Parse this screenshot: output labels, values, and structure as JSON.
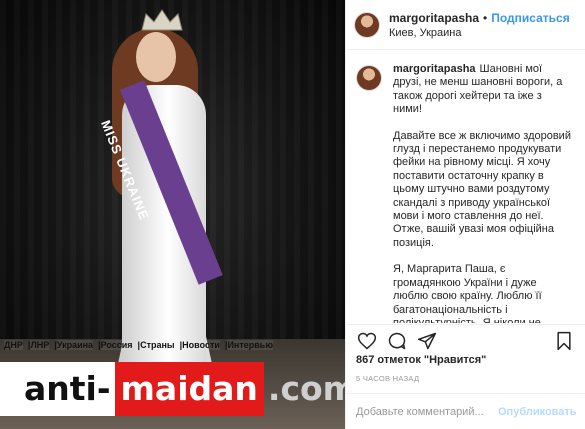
{
  "photo": {
    "sash_text": "MISS UKRAINE",
    "news_links": [
      "ДНР",
      "ЛНР",
      "Украина",
      "Россия",
      "Страны",
      "Новости",
      "Интервью"
    ],
    "watermark": {
      "part1": "anti-",
      "part2": "maidan",
      "part3": ".com"
    }
  },
  "header": {
    "username": "margoritapasha",
    "separator": "•",
    "follow_label": "Подписаться",
    "location": "Киев, Украина"
  },
  "caption": {
    "username": "margoritapasha",
    "paragraphs": [
      "Шановні мої друзі, не менш шановні вороги, а також дорогі хейтери та іже з ними!",
      "Давайте все ж включимо здоровий глузд і перестанемо продукувати фейки на рівному місці. Я хочу поставити остаточну крапку в цьому штучно вами роздутому скандалі з приводу української мови і мого ставлення до неї. Отже, вашій увазі моя офіційна позиція.",
      "Я, Маргарита Паша, є громадянкою України і дуже люблю свою країну. Люблю її багатонаціональність і полікультурність. Я ніколи не ставила під сумнів її державність, національну символіку і державну"
    ]
  },
  "actions": {
    "like_icon": "heart-icon",
    "comment_icon": "comment-icon",
    "share_icon": "share-icon",
    "save_icon": "bookmark-icon"
  },
  "likes_text": "867 отметок \"Нравится\"",
  "timestamp": "5 ЧАСОВ НАЗАД",
  "comment_box": {
    "placeholder": "Добавьте комментарий...",
    "publish_label": "Опубликовать"
  },
  "colors": {
    "link_blue": "#3897f0",
    "publish_disabled": "#b3dbff",
    "watermark_red": "#e21a1a",
    "sash_purple": "#6b3f8f"
  }
}
